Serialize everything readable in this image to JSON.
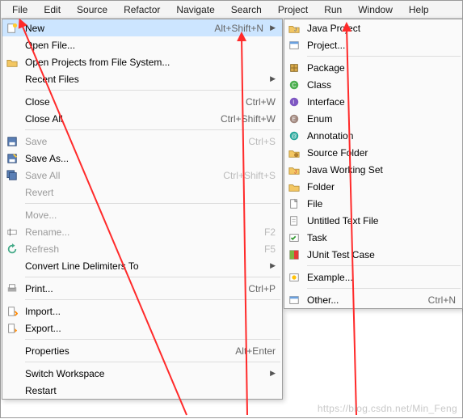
{
  "menubar": [
    "File",
    "Edit",
    "Source",
    "Refactor",
    "Navigate",
    "Search",
    "Project",
    "Run",
    "Window",
    "Help"
  ],
  "file_menu": {
    "items": [
      {
        "label": "New",
        "accel": "Alt+Shift+N",
        "sub": true,
        "selected": true,
        "icon": "new"
      },
      {
        "label": "Open File...",
        "icon": "none"
      },
      {
        "label": "Open Projects from File System...",
        "icon": "folder-proj"
      },
      {
        "label": "Recent Files",
        "sub": true,
        "icon": "none"
      },
      {
        "sep": true
      },
      {
        "label": "Close",
        "accel": "Ctrl+W",
        "icon": "none"
      },
      {
        "label": "Close All",
        "accel": "Ctrl+Shift+W",
        "icon": "none"
      },
      {
        "sep": true
      },
      {
        "label": "Save",
        "accel": "Ctrl+S",
        "disabled": true,
        "icon": "save"
      },
      {
        "label": "Save As...",
        "icon": "save-as"
      },
      {
        "label": "Save All",
        "accel": "Ctrl+Shift+S",
        "disabled": true,
        "icon": "save-all"
      },
      {
        "label": "Revert",
        "disabled": true,
        "icon": "none"
      },
      {
        "sep": true
      },
      {
        "label": "Move...",
        "disabled": true,
        "icon": "none"
      },
      {
        "label": "Rename...",
        "accel": "F2",
        "disabled": true,
        "icon": "rename"
      },
      {
        "label": "Refresh",
        "accel": "F5",
        "disabled": true,
        "icon": "refresh"
      },
      {
        "label": "Convert Line Delimiters To",
        "sub": true,
        "icon": "none"
      },
      {
        "sep": true
      },
      {
        "label": "Print...",
        "accel": "Ctrl+P",
        "icon": "print"
      },
      {
        "sep": true
      },
      {
        "label": "Import...",
        "icon": "import"
      },
      {
        "label": "Export...",
        "icon": "export"
      },
      {
        "sep": true
      },
      {
        "label": "Properties",
        "accel": "Alt+Enter",
        "icon": "none"
      },
      {
        "sep": true
      },
      {
        "label": "Switch Workspace",
        "sub": true,
        "icon": "none"
      },
      {
        "label": "Restart",
        "icon": "none"
      }
    ]
  },
  "new_menu": {
    "items": [
      {
        "label": "Java Project",
        "icon": "java-proj"
      },
      {
        "label": "Project...",
        "icon": "proj"
      },
      {
        "sep": true
      },
      {
        "label": "Package",
        "icon": "package"
      },
      {
        "label": "Class",
        "icon": "class"
      },
      {
        "label": "Interface",
        "icon": "interface"
      },
      {
        "label": "Enum",
        "icon": "enum"
      },
      {
        "label": "Annotation",
        "icon": "annotation"
      },
      {
        "label": "Source Folder",
        "icon": "src-folder"
      },
      {
        "label": "Java Working Set",
        "icon": "working-set"
      },
      {
        "label": "Folder",
        "icon": "folder"
      },
      {
        "label": "File",
        "icon": "file"
      },
      {
        "label": "Untitled Text File",
        "icon": "text-file"
      },
      {
        "label": "Task",
        "icon": "task"
      },
      {
        "label": "JUnit Test Case",
        "icon": "junit"
      },
      {
        "sep": true
      },
      {
        "label": "Example...",
        "icon": "example"
      },
      {
        "sep": true
      },
      {
        "label": "Other...",
        "accel": "Ctrl+N",
        "icon": "wizard"
      }
    ]
  },
  "watermark": "https://blog.csdn.net/Min_Feng"
}
